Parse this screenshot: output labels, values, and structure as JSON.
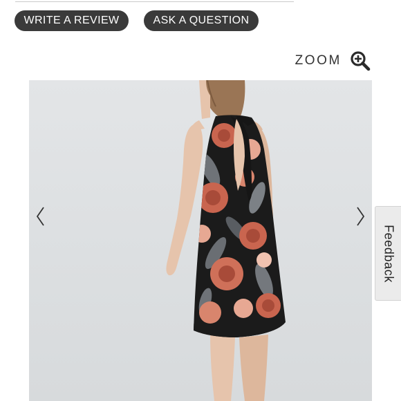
{
  "actions": {
    "write_review_label": "WRITE A REVIEW",
    "ask_question_label": "ASK A QUESTION"
  },
  "zoom": {
    "label": "ZOOM",
    "icon": "zoom-in-magnifier-icon"
  },
  "gallery": {
    "image_description": "",
    "prev_icon": "chevron-left-icon",
    "next_icon": "chevron-right-icon"
  },
  "feedback": {
    "label": "Feedback"
  },
  "colors": {
    "button_bg": "#3a3a3a",
    "button_text": "#ffffff",
    "photo_bg": "#dfe2e4",
    "dress_black": "#1b1b1b",
    "flower_coral": "#c9654f",
    "flower_blush": "#e7a893",
    "leaf_grey": "#6f7378",
    "skin": "#e6c4ac",
    "hair": "#9a7555"
  }
}
